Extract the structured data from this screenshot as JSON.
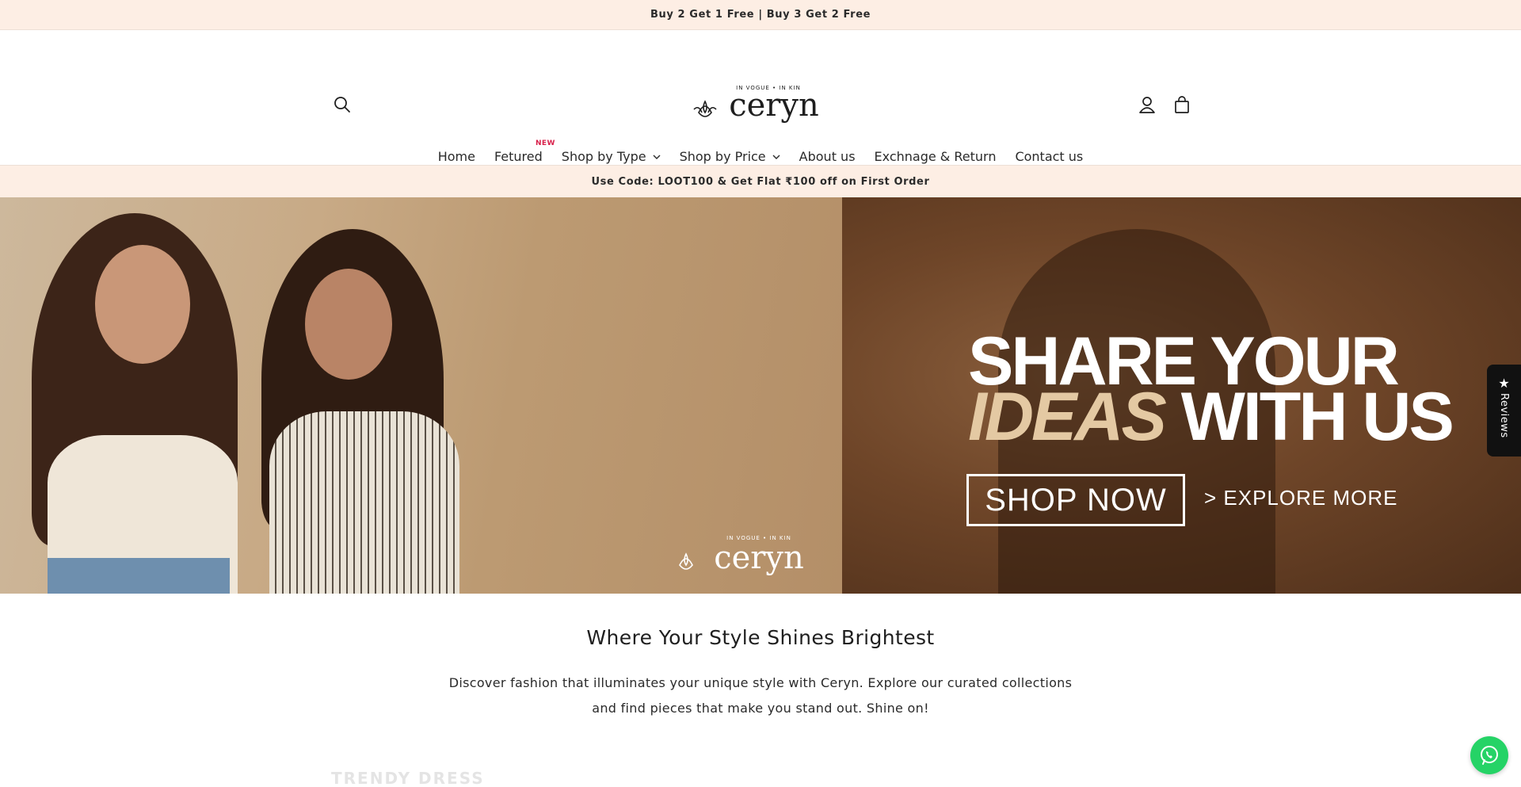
{
  "announcement": {
    "text": "Buy 2 Get 1 Free | Buy 3 Get 2 Free"
  },
  "header": {
    "logo_text": "ceryn",
    "logo_tagline": "IN VOGUE • IN KIN"
  },
  "nav": {
    "items": [
      {
        "label": "Home",
        "active": true
      },
      {
        "label": "Fetured",
        "badge": "NEW"
      },
      {
        "label": "Shop by Type",
        "dropdown": true
      },
      {
        "label": "Shop by Price",
        "dropdown": true
      },
      {
        "label": "About us"
      },
      {
        "label": "Exchnage & Return"
      },
      {
        "label": "Contact us"
      }
    ]
  },
  "promo": {
    "text": "Use Code: LOOT100 & Get Flat ₹100 off on First Order"
  },
  "hero": {
    "title_line1": "SHARE YOUR",
    "title_emphasis": "IDEAS",
    "title_line2_rest": " WITH US",
    "shop_now": "SHOP NOW",
    "explore": "> EXPLORE MORE",
    "brand_mark": "ceryn",
    "brand_tagline": "IN VOGUE • IN KIN"
  },
  "reviews": {
    "label": "Reviews"
  },
  "intro": {
    "title": "Where Your Style Shines Brightest",
    "text": "Discover fashion that illuminates your unique style with Ceryn. Explore our curated collections and find pieces that make you stand out. Shine on!"
  },
  "next_section": {
    "title": "TRENDY DRESS"
  },
  "colors": {
    "announcement_bg": "#fdeee4",
    "new_badge": "#d8204a",
    "hero_accent": "#e4c9a3",
    "whatsapp": "#25d366"
  },
  "icons": [
    "search-icon",
    "user-icon",
    "cart-icon",
    "chevron-down-icon",
    "star-icon",
    "whatsapp-icon"
  ]
}
